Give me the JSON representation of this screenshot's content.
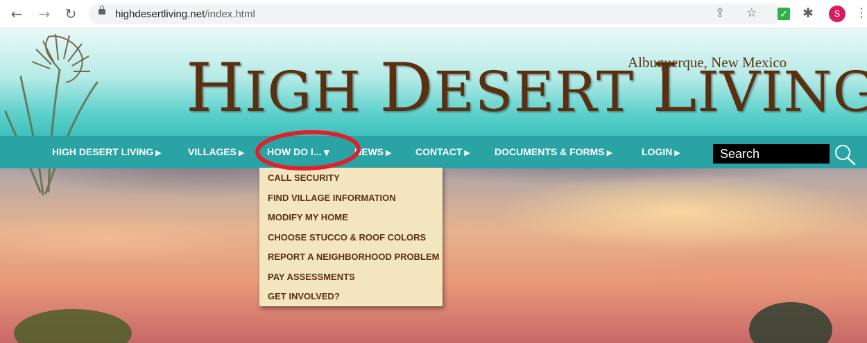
{
  "browser": {
    "url_domain": "highdesertliving.net",
    "url_path": "/index.html",
    "avatar_letter": "S"
  },
  "site": {
    "title_parts": [
      "H",
      "IGH ",
      "D",
      "ESERT ",
      "L",
      "IVING"
    ],
    "location": "Albuquerque, New Mexico"
  },
  "nav": {
    "items": [
      {
        "label": "HIGH DESERT LIVING",
        "arrow": "▶"
      },
      {
        "label": "VILLAGES",
        "arrow": "▶"
      },
      {
        "label": "HOW DO I...",
        "arrow": "▼"
      },
      {
        "label": "NEWS",
        "arrow": "▶"
      },
      {
        "label": "CONTACT",
        "arrow": "▶"
      },
      {
        "label": "DOCUMENTS & FORMS",
        "arrow": "▶"
      },
      {
        "label": "LOGIN",
        "arrow": "▶"
      }
    ],
    "search_placeholder": "Search"
  },
  "dropdown": {
    "items": [
      "CALL SECURITY",
      "FIND VILLAGE INFORMATION",
      "MODIFY MY HOME",
      "CHOOSE STUCCO & ROOF COLORS",
      "REPORT A NEIGHBORHOOD PROBLEM",
      "PAY ASSESSMENTS",
      "GET INVOLVED?"
    ]
  },
  "colors": {
    "nav_bg": "#2aa3a5",
    "title_brown": "#5a3010",
    "dropdown_bg": "#f3e5c0",
    "annotation_red": "#e0202a"
  },
  "icons": {
    "back": "back-arrow-icon",
    "forward": "forward-arrow-icon",
    "reload": "reload-icon",
    "lock": "lock-icon",
    "share": "share-icon",
    "bookmark": "star-icon",
    "extension1": "checkmark-extension-icon",
    "extension2": "puzzle-icon",
    "menu": "kebab-menu-icon",
    "search": "magnifier-icon"
  }
}
